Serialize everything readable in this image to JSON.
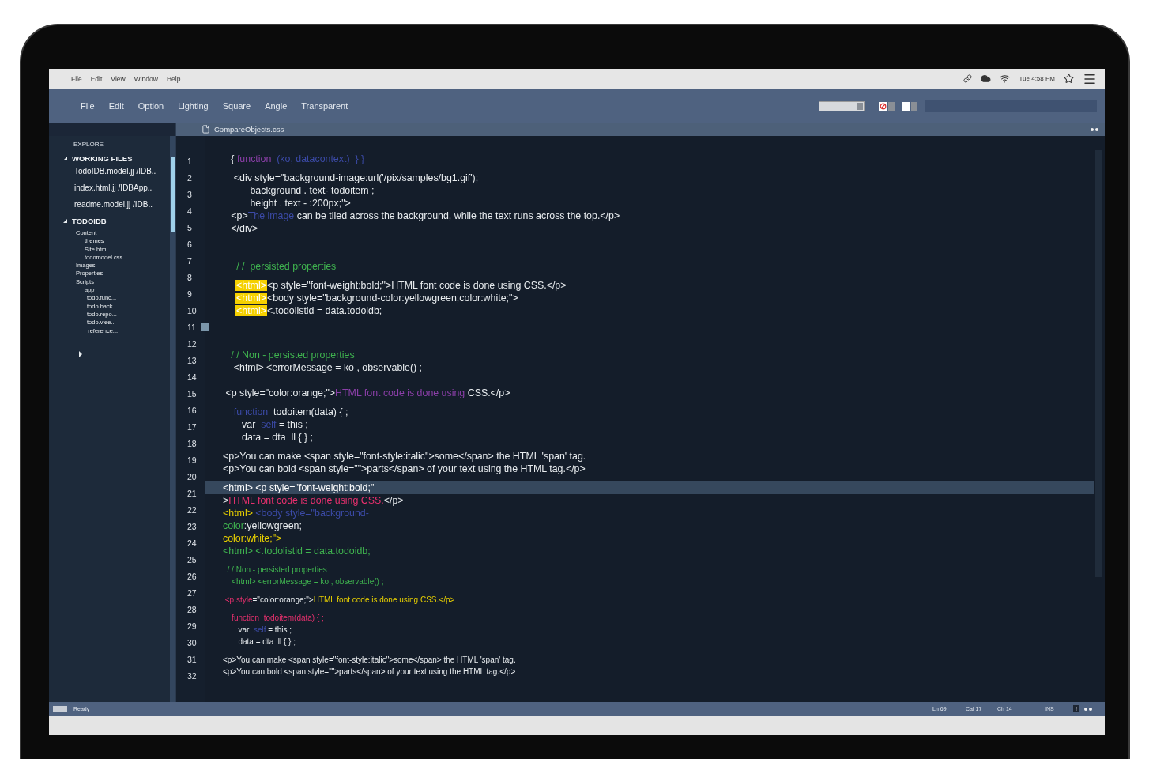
{
  "menubar": {
    "items": [
      "File",
      "Edit",
      "View",
      "Window",
      "Help"
    ],
    "clock": "Tue 4:58 PM"
  },
  "toolbar": {
    "items": [
      "File",
      "Edit",
      "Option",
      "Lighting",
      "Square",
      "Angle",
      "Transparent"
    ]
  },
  "sidebar": {
    "title": "EXPLORE",
    "working_files": {
      "label": "WORKING FILES",
      "expanded": true,
      "files": [
        {
          "name": "TodoIDB.model.jj",
          "path": "/IDB.."
        },
        {
          "name": "index.html.jj",
          "path": "/IDBApp.."
        },
        {
          "name": "readme.model.jj",
          "path": "/IDB.."
        }
      ]
    },
    "project": {
      "label": "TODOIDB",
      "expanded": true,
      "tree": [
        {
          "label": "Content",
          "children": [
            {
              "label": "themes"
            },
            {
              "label": "Site.html"
            },
            {
              "label": "todomodel.css"
            }
          ]
        },
        {
          "label": "Images"
        },
        {
          "label": "Properties"
        },
        {
          "label": "Scripts",
          "children": [
            {
              "label": "app",
              "children": [
                {
                  "label": "todo.func..."
                },
                {
                  "label": "todo.back..."
                },
                {
                  "label": "todo.repo..."
                },
                {
                  "label": "todo.viee.."
                }
              ]
            },
            {
              "label": "_reference..."
            }
          ]
        }
      ]
    }
  },
  "editor": {
    "tab": "CompareObjects.css",
    "line_numbers": [
      "1",
      "2",
      "3",
      "4",
      "5",
      "6",
      "7",
      "8",
      "9",
      "10",
      "11",
      "12",
      "13",
      "14",
      "15",
      "16",
      "17",
      "18",
      "19",
      "20",
      "21",
      "22",
      "23",
      "24",
      "25",
      "26",
      "27",
      "28",
      "29",
      "30",
      "31",
      "32"
    ],
    "lines": [
      {
        "kind": "code",
        "segments": [
          {
            "text": "   { ",
            "kind": "plain"
          },
          {
            "text": "function  ",
            "kind": "keyword"
          },
          {
            "text": "(ko, datacontext)  } }",
            "kind": "name"
          }
        ]
      },
      {
        "kind": "gap"
      },
      {
        "kind": "code",
        "segments": [
          {
            "text": "    <div style=\"background-image:url('/pix/samples/bg1.gif');",
            "kind": "plain"
          }
        ]
      },
      {
        "kind": "code",
        "segments": [
          {
            "text": "          background . text- todoitem ;",
            "kind": "plain"
          }
        ]
      },
      {
        "kind": "code",
        "segments": [
          {
            "text": "          height . text - :200px;\">",
            "kind": "plain"
          }
        ]
      },
      {
        "kind": "code",
        "segments": [
          {
            "text": "   <p>",
            "kind": "plain"
          },
          {
            "text": "The image",
            "kind": "name"
          },
          {
            "text": " can be tiled across the background, while the text runs across the top.</p>",
            "kind": "plain"
          }
        ]
      },
      {
        "kind": "code",
        "segments": [
          {
            "text": "   </div>",
            "kind": "plain"
          }
        ]
      },
      {
        "kind": "blank"
      },
      {
        "kind": "blank"
      },
      {
        "kind": "code",
        "segments": [
          {
            "text": "     / /  persisted properties",
            "kind": "comment"
          }
        ]
      },
      {
        "kind": "gap"
      },
      {
        "kind": "marked",
        "segments": [
          {
            "text": "<html>",
            "kind": "bright"
          },
          {
            "text": "<p style=\"font-weight:bold;\">HTML font code is done using CSS.</p>",
            "kind": "plain"
          }
        ]
      },
      {
        "kind": "marked",
        "segments": [
          {
            "text": "<html>",
            "kind": "bright"
          },
          {
            "text": "<body style=\"background-color:yellowgreen;color:white;\">",
            "kind": "plain"
          }
        ]
      },
      {
        "kind": "marked",
        "segments": [
          {
            "text": "<html>",
            "kind": "bright"
          },
          {
            "text": "<.todolistid = data.todoidb;",
            "kind": "plain"
          }
        ]
      },
      {
        "kind": "blank"
      },
      {
        "kind": "blank"
      },
      {
        "kind": "gap"
      },
      {
        "kind": "code",
        "segments": [
          {
            "text": "   / / Non - persisted properties",
            "kind": "comment"
          }
        ]
      },
      {
        "kind": "code",
        "segments": [
          {
            "text": "    <html> <errorMessage = ko , observable() ;",
            "kind": "plain"
          }
        ]
      },
      {
        "kind": "blank"
      },
      {
        "kind": "code",
        "segments": [
          {
            "text": " <p style=\"color:orange;\">",
            "kind": "plain"
          },
          {
            "text": "HTML font code is done using ",
            "kind": "keyword"
          },
          {
            "text": "CSS.</p>",
            "kind": "plain"
          }
        ]
      },
      {
        "kind": "gap"
      },
      {
        "kind": "code",
        "segments": [
          {
            "text": "    function  ",
            "kind": "name"
          },
          {
            "text": "todoitem(data) { ;",
            "kind": "plain"
          }
        ]
      },
      {
        "kind": "code",
        "segments": [
          {
            "text": "       var  ",
            "kind": "plain"
          },
          {
            "text": "self",
            "kind": "name"
          },
          {
            "text": " = this ;",
            "kind": "plain"
          }
        ]
      },
      {
        "kind": "code",
        "segments": [
          {
            "text": "       data = dta  ll { } ;",
            "kind": "plain"
          }
        ]
      },
      {
        "kind": "gap"
      },
      {
        "kind": "code",
        "segments": [
          {
            "text": "<p>You can make <span style=\"font-style:italic\">some</span> the HTML 'span' tag.",
            "kind": "plain"
          }
        ]
      },
      {
        "kind": "code",
        "segments": [
          {
            "text": "<p>You can bold <span style=\"\">parts</span> of your text using the HTML tag.</p>",
            "kind": "plain"
          }
        ]
      },
      {
        "kind": "gap"
      },
      {
        "kind": "current",
        "segments": [
          {
            "text": "<html> <p style=\"font-weight:bold;\"",
            "kind": "bright"
          }
        ]
      },
      {
        "kind": "code",
        "segments": [
          {
            "text": ">",
            "kind": "plain"
          },
          {
            "text": "HTML font code is done using CSS.",
            "kind": "accent"
          },
          {
            "text": "</p>",
            "kind": "plain"
          }
        ]
      },
      {
        "kind": "code",
        "segments": [
          {
            "text": "<html> ",
            "kind": "tag"
          },
          {
            "text": "<body style=\"background-",
            "kind": "name"
          }
        ]
      },
      {
        "kind": "code",
        "segments": [
          {
            "text": "color",
            "kind": "comment"
          },
          {
            "text": ":yellowgreen;",
            "kind": "plain"
          }
        ]
      },
      {
        "kind": "code",
        "segments": [
          {
            "text": "color:white;\">",
            "kind": "tag"
          }
        ]
      },
      {
        "kind": "code",
        "segments": [
          {
            "text": "<html> <.todolistid = data.todoidb;",
            "kind": "comment"
          }
        ]
      },
      {
        "kind": "gap"
      },
      {
        "kind": "small",
        "segments": [
          {
            "text": "  / / Non - persisted properties",
            "kind": "comment"
          }
        ]
      },
      {
        "kind": "small",
        "segments": [
          {
            "text": "    <html> <errorMessage = ko , observable() ;",
            "kind": "comment"
          }
        ]
      },
      {
        "kind": "gap"
      },
      {
        "kind": "small",
        "segments": [
          {
            "text": " <p style",
            "kind": "accent"
          },
          {
            "text": "=\"color:orange;\">",
            "kind": "plain"
          },
          {
            "text": "HTML font code is done using CSS.</p>",
            "kind": "tag"
          }
        ]
      },
      {
        "kind": "gap"
      },
      {
        "kind": "small",
        "segments": [
          {
            "text": "    function  todoitem(data) { ;",
            "kind": "accent"
          }
        ]
      },
      {
        "kind": "small",
        "segments": [
          {
            "text": "       var  ",
            "kind": "plain"
          },
          {
            "text": "self",
            "kind": "name"
          },
          {
            "text": " = this ;",
            "kind": "plain"
          }
        ]
      },
      {
        "kind": "small",
        "segments": [
          {
            "text": "       data = dta  ll { } ;",
            "kind": "plain"
          }
        ]
      },
      {
        "kind": "gap"
      },
      {
        "kind": "small",
        "segments": [
          {
            "text": "<p>You can make <span style=\"font-style:italic\">some</span> the HTML 'span' tag.",
            "kind": "plain"
          }
        ]
      },
      {
        "kind": "small",
        "segments": [
          {
            "text": "<p>You can bold <span style=\"\">parts</span> of your text using the HTML tag.</p>",
            "kind": "plain"
          }
        ]
      }
    ]
  },
  "status_bar": {
    "message": "Ready",
    "items": [
      "Ln 69",
      "Cal 17",
      "Ch 14",
      "INS"
    ],
    "alert": "!"
  }
}
